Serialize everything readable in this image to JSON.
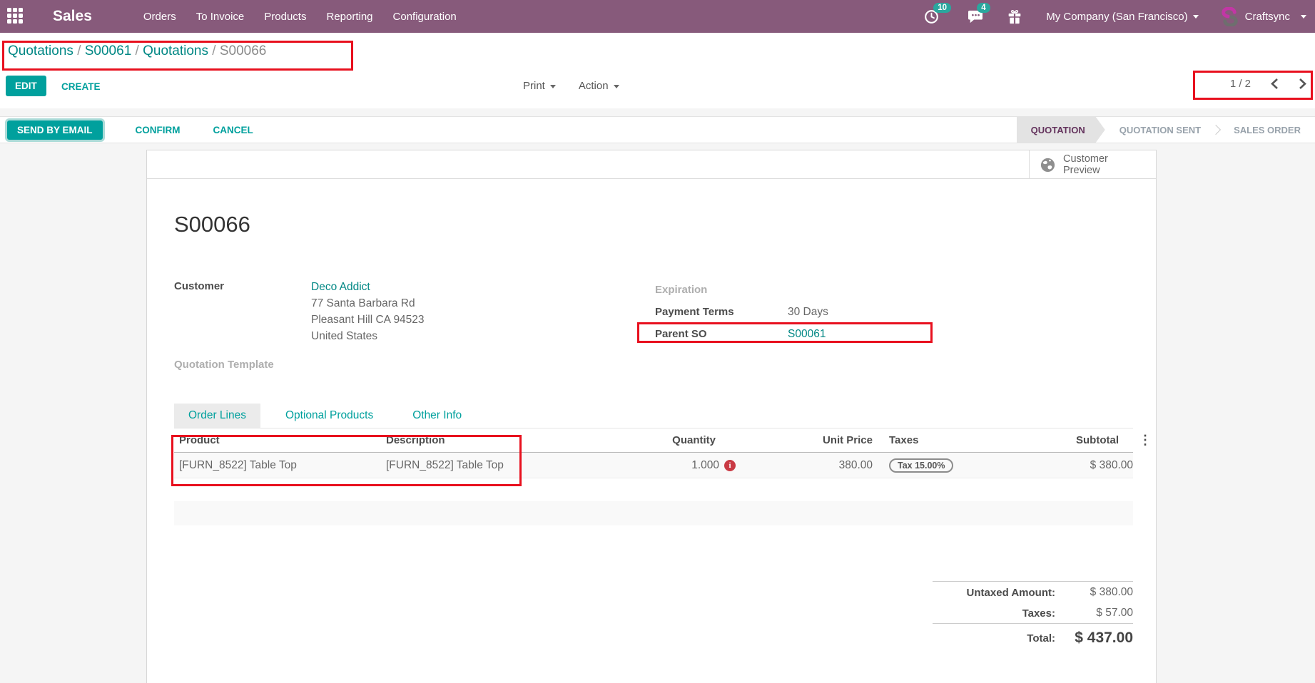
{
  "topbar": {
    "app_name": "Sales",
    "nav": [
      "Orders",
      "To Invoice",
      "Products",
      "Reporting",
      "Configuration"
    ],
    "activity_count": "10",
    "message_count": "4",
    "company": "My Company (San Francisco)",
    "user": "Craftsync"
  },
  "breadcrumb": {
    "link1": "Quotations",
    "link2": "S00061",
    "link3": "Quotations",
    "current": "S00066",
    "separator": "/"
  },
  "control_panel": {
    "edit": "EDIT",
    "create": "CREATE",
    "print": "Print",
    "action": "Action",
    "pager": "1 / 2"
  },
  "statusbar": {
    "send_by_email": "SEND BY EMAIL",
    "confirm": "CONFIRM",
    "cancel": "CANCEL",
    "steps": [
      {
        "label": "QUOTATION",
        "active": true
      },
      {
        "label": "QUOTATION SENT",
        "active": false
      },
      {
        "label": "SALES ORDER",
        "active": false
      }
    ]
  },
  "sheet": {
    "preview_label": "Customer Preview",
    "title": "S00066",
    "customer_label": "Customer",
    "customer_name": "Deco Addict",
    "customer_address": [
      "77 Santa Barbara Rd",
      "Pleasant Hill CA 94523",
      "United States"
    ],
    "quotation_template_label": "Quotation Template",
    "expiration_label": "Expiration",
    "payment_terms_label": "Payment Terms",
    "payment_terms_value": "30 Days",
    "parent_so_label": "Parent SO",
    "parent_so_value": "S00061",
    "tabs": [
      "Order Lines",
      "Optional Products",
      "Other Info"
    ],
    "table": {
      "headers": [
        "Product",
        "Description",
        "Quantity",
        "Unit Price",
        "Taxes",
        "Subtotal"
      ],
      "row": {
        "product": "[FURN_8522] Table Top",
        "description": "[FURN_8522] Table Top",
        "quantity": "1.000",
        "unit_price": "380.00",
        "taxes": "Tax 15.00%",
        "subtotal": "$ 380.00"
      }
    },
    "totals": {
      "untaxed_label": "Untaxed Amount:",
      "untaxed_value": "$ 380.00",
      "taxes_label": "Taxes:",
      "taxes_value": "$ 57.00",
      "total_label": "Total:",
      "total_value": "$ 437.00"
    }
  },
  "colors": {
    "topbar_purple": "#875A7B",
    "accent_teal": "#00A09D",
    "link_teal": "#008784",
    "active_step_text": "#63325C",
    "annotation_red": "#E8101E",
    "danger_red": "#C93A44"
  }
}
